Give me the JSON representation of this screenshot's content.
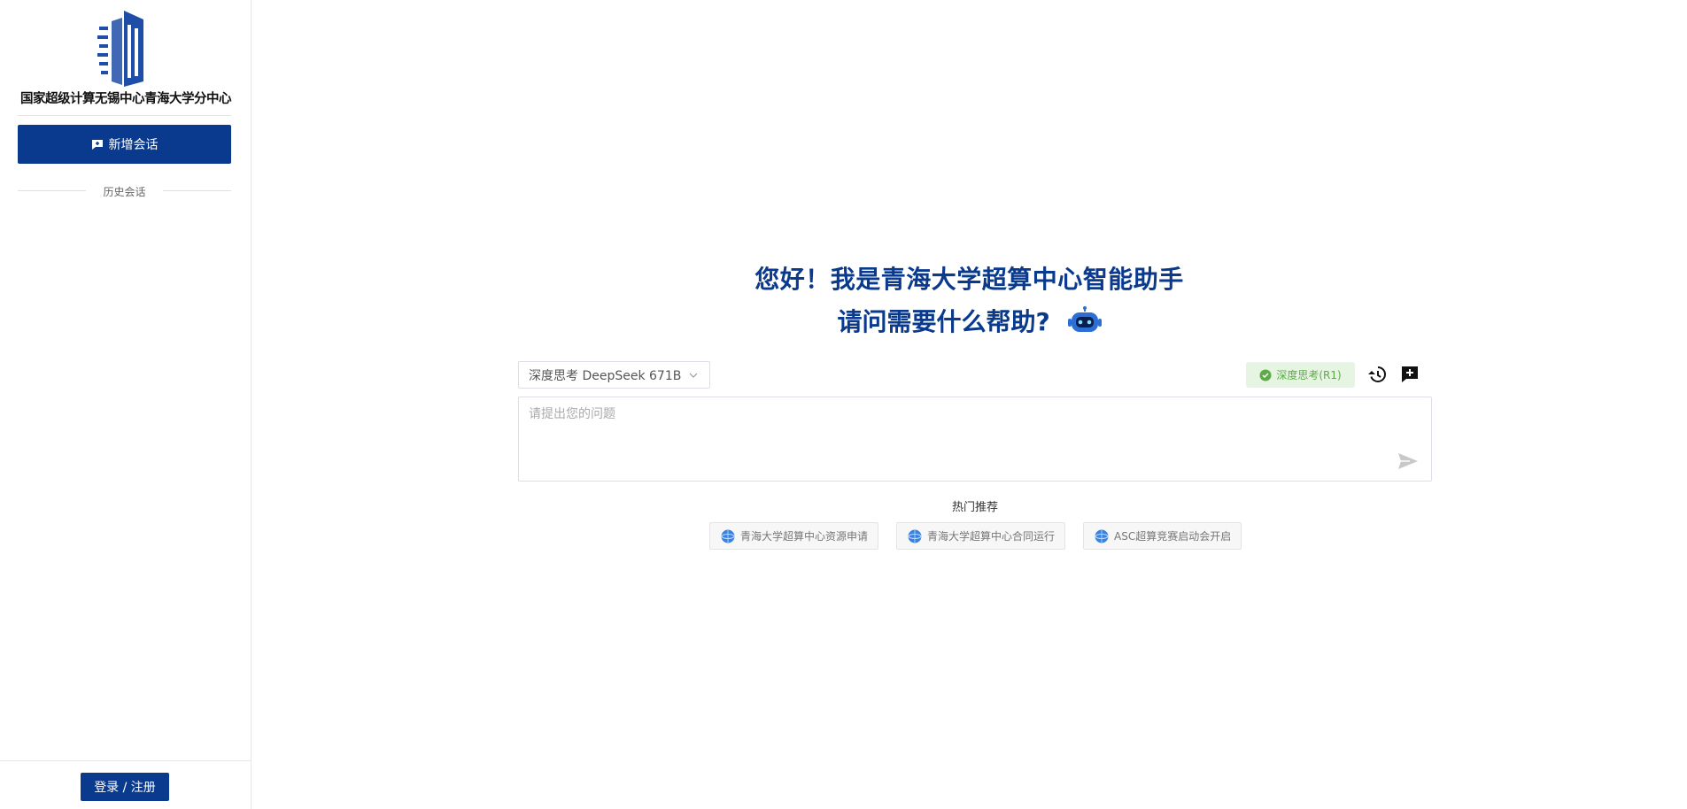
{
  "sidebar": {
    "logo_text": "国家超级计算无锡中心青海大学分中心",
    "new_chat_label": "新增会话",
    "history_label": "历史会话",
    "login_label": "登录 / 注册"
  },
  "main": {
    "greeting_line1": "您好！我是青海大学超算中心智能助手",
    "greeting_line2": "请问需要什么帮助?",
    "model_select_value": "深度思考 DeepSeek 671B",
    "deep_think_label": "深度思考(R1)",
    "question_placeholder": "请提出您的问题",
    "hot_title": "热门推荐",
    "hot_items": [
      "青海大学超算中心资源申请",
      "青海大学超算中心合同运行",
      "ASC超算竞赛启动会开启"
    ]
  },
  "colors": {
    "brand": "#0a3a8e",
    "deep_think_bg": "#e6f4e2",
    "deep_think_text": "#5cab46"
  },
  "icons": [
    "logo-building-icon",
    "new-chat-icon",
    "robot-icon",
    "chevron-down-icon",
    "check-circle-icon",
    "history-icon",
    "add-chat-icon",
    "send-icon",
    "globe-icon"
  ]
}
